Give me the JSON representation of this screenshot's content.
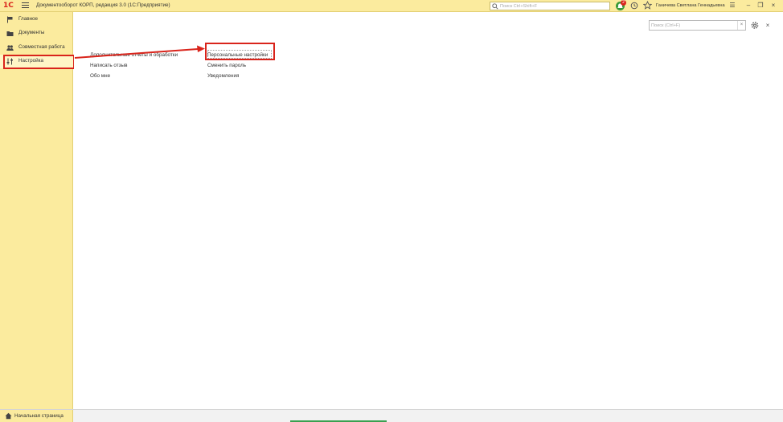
{
  "titlebar": {
    "logo": "1С",
    "title": "Документооборот КОРП, редакция 3.0  (1С:Предприятие)",
    "search_placeholder": "Поиск Ctrl+Shift+F",
    "notification_count": "2",
    "user": "Ганичева Светлана Геннадьевна",
    "menu_glyph": "☰",
    "minimize_glyph": "–",
    "restore_glyph": "❐",
    "close_glyph": "×"
  },
  "sidebar": {
    "items": [
      {
        "label": "Главное",
        "icon": "flag-icon"
      },
      {
        "label": "Документы",
        "icon": "folder-icon"
      },
      {
        "label": "Совместная работа",
        "icon": "users-icon"
      },
      {
        "label": "Настройка",
        "icon": "sliders-icon"
      }
    ]
  },
  "bottombar": {
    "start_page": "Начальная страница"
  },
  "content": {
    "search_placeholder": "Поиск (Ctrl+F)",
    "clear_glyph": "×",
    "close_glyph": "×",
    "column1": [
      "Дополнительные отчеты и обработки",
      "Написать отзыв",
      "Обо мне"
    ],
    "column2": [
      "Персональные настройки",
      "Сменить пароль",
      "Уведомления"
    ]
  },
  "colors": {
    "panel": "#fbeb9e",
    "highlight": "#d9241b",
    "notification": "#3a9a3a"
  }
}
